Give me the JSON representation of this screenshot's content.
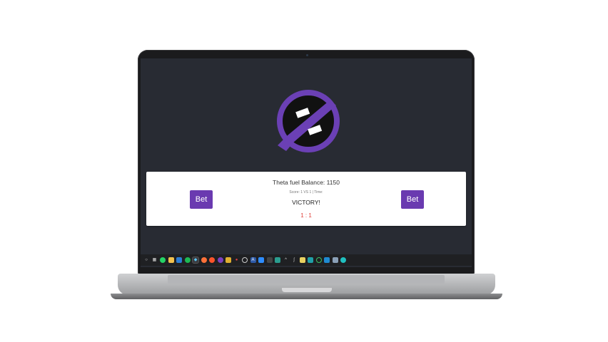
{
  "app": {
    "balance_text": "Theta fuel Balance: 1150",
    "score_text": "Score: 1 VS 1 | Time:",
    "status_text": "VICTORY!",
    "tally_text": "1 : 1",
    "bet_left_label": "Bet",
    "bet_right_label": "Bet"
  },
  "colors": {
    "accent": "#6a3ab0",
    "background": "#282b33",
    "tally": "#e0403a"
  },
  "taskbar": {
    "icons": [
      "start-icon",
      "task-view-icon",
      "whatsapp-icon",
      "file-explorer-icon",
      "mail-icon",
      "spotify-icon",
      "active-app-icon",
      "firefox-icon",
      "brave-icon",
      "github-icon",
      "tool-icon",
      "app-icon",
      "clock-icon",
      "aegis-icon",
      "zoom-icon",
      "remote-icon",
      "terminal-icon",
      "chevron-up-icon",
      "mic-icon",
      "notes-icon",
      "teams-icon",
      "sync-icon",
      "vscode-icon",
      "photos-icon",
      "settings-icon"
    ]
  }
}
